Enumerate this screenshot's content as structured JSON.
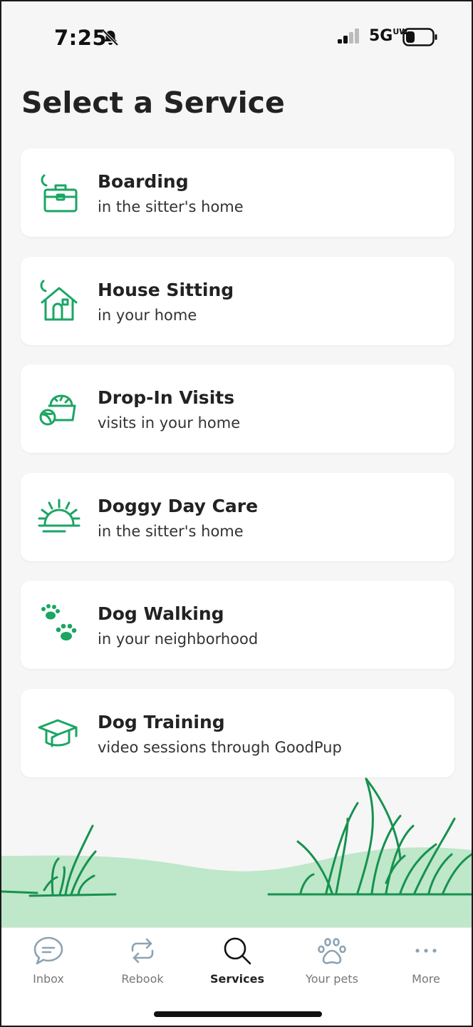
{
  "status_bar": {
    "time": "7:25",
    "network": "5G",
    "network_sub": "UW",
    "icons": [
      "bell-slash-icon",
      "signal-icon",
      "battery-icon"
    ]
  },
  "page": {
    "title": "Select a Service"
  },
  "services": [
    {
      "name": "Boarding",
      "description": "in the sitter's home",
      "icon": "suitcase-moon-icon"
    },
    {
      "name": "House Sitting",
      "description": "in your home",
      "icon": "house-moon-icon"
    },
    {
      "name": "Drop-In Visits",
      "description": "visits in your home",
      "icon": "food-bowl-ball-icon"
    },
    {
      "name": "Doggy Day Care",
      "description": "in the sitter's home",
      "icon": "sunrise-icon"
    },
    {
      "name": "Dog Walking",
      "description": "in your neighborhood",
      "icon": "paw-prints-icon"
    },
    {
      "name": "Dog Training",
      "description": "video sessions through GoodPup",
      "icon": "graduation-cap-icon"
    }
  ],
  "tab_bar": {
    "tabs": [
      {
        "label": "Inbox",
        "icon": "chat-bubble-icon",
        "active": false
      },
      {
        "label": "Rebook",
        "icon": "rebook-arrows-icon",
        "active": false
      },
      {
        "label": "Services",
        "icon": "search-icon",
        "active": true
      },
      {
        "label": "Your pets",
        "icon": "paw-icon",
        "active": false
      },
      {
        "label": "More",
        "icon": "more-dots-icon",
        "active": false
      }
    ]
  },
  "colors": {
    "accent_green": "#1aa663",
    "grass_dark": "#15924f",
    "grass_light": "#bfe7c9",
    "background": "#f6f6f6",
    "card": "#ffffff",
    "tab_inactive": "#777777",
    "tab_icon_inactive": "#8da3b3"
  }
}
